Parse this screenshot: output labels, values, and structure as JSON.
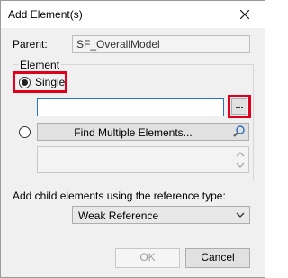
{
  "dialog": {
    "title": "Add Element(s)"
  },
  "parent": {
    "label": "Parent:",
    "value": "SF_OverallModel"
  },
  "element_group": {
    "legend": "Element",
    "single_label": "Single",
    "single_value": "",
    "browse_label": "...",
    "find_multiple_label": "Find Multiple Elements..."
  },
  "reference": {
    "label": "Add child elements using the reference type:",
    "selected": "Weak Reference"
  },
  "buttons": {
    "ok": "OK",
    "cancel": "Cancel"
  },
  "colors": {
    "highlight": "#e0001b",
    "focus_border": "#2a72c8"
  },
  "icons": {
    "close": "close-icon",
    "search": "search-icon",
    "dropdown": "chevron-down-icon"
  }
}
